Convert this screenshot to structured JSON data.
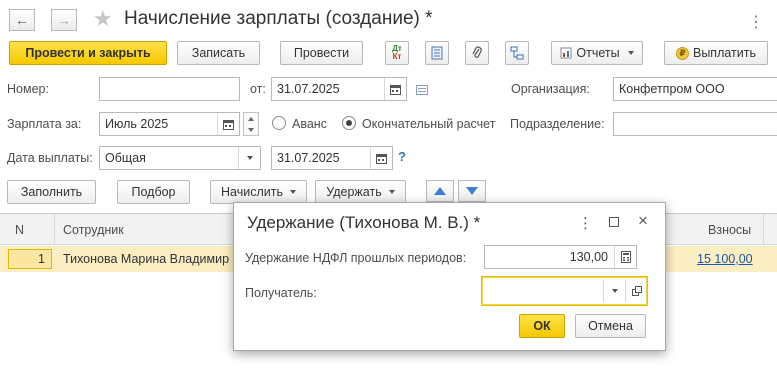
{
  "window": {
    "title": "Начисление зарплаты (создание) *"
  },
  "toolbar": {
    "post_and_close": "Провести и закрыть",
    "save": "Записать",
    "post": "Провести",
    "dt_kt_top": "Дт",
    "dt_kt_bottom": "Кт",
    "reports": "Отчеты",
    "pay": "Выплатить"
  },
  "form": {
    "number_label": "Номер:",
    "number_value": "",
    "date_from_label": "от:",
    "date_value": "31.07.2025",
    "organization_label": "Организация:",
    "organization_value": "Конфетпром ООО",
    "salary_for_label": "Зарплата за:",
    "salary_for_value": "Июль 2025",
    "radio_advance": "Аванс",
    "radio_final": "Окончательный расчет",
    "radio_selected": "final",
    "division_label": "Подразделение:",
    "division_value": "",
    "payment_date_label": "Дата выплаты:",
    "payment_type_value": "Общая",
    "payment_date_value": "31.07.2025",
    "help": "?"
  },
  "table_toolbar": {
    "fill": "Заполнить",
    "select": "Подбор",
    "accrue": "Начислить",
    "withhold": "Удержать"
  },
  "table": {
    "columns": [
      "N",
      "Сотрудник",
      "Взносы"
    ],
    "rows": [
      {
        "n": "1",
        "employee": "Тихонова Марина Владимир",
        "contributions": "15 100,00"
      }
    ]
  },
  "dialog": {
    "title": "Удержание (Тихонова М. В.) *",
    "ndfl_label": "Удержание НДФЛ прошлых периодов:",
    "ndfl_value": "130,00",
    "recipient_label": "Получатель:",
    "recipient_value": "",
    "ok": "ОК",
    "cancel": "Отмена"
  },
  "colors": {
    "accent_yellow": "#f5c800",
    "selected_row": "#fbeec3",
    "link_blue": "#1a55a8"
  }
}
